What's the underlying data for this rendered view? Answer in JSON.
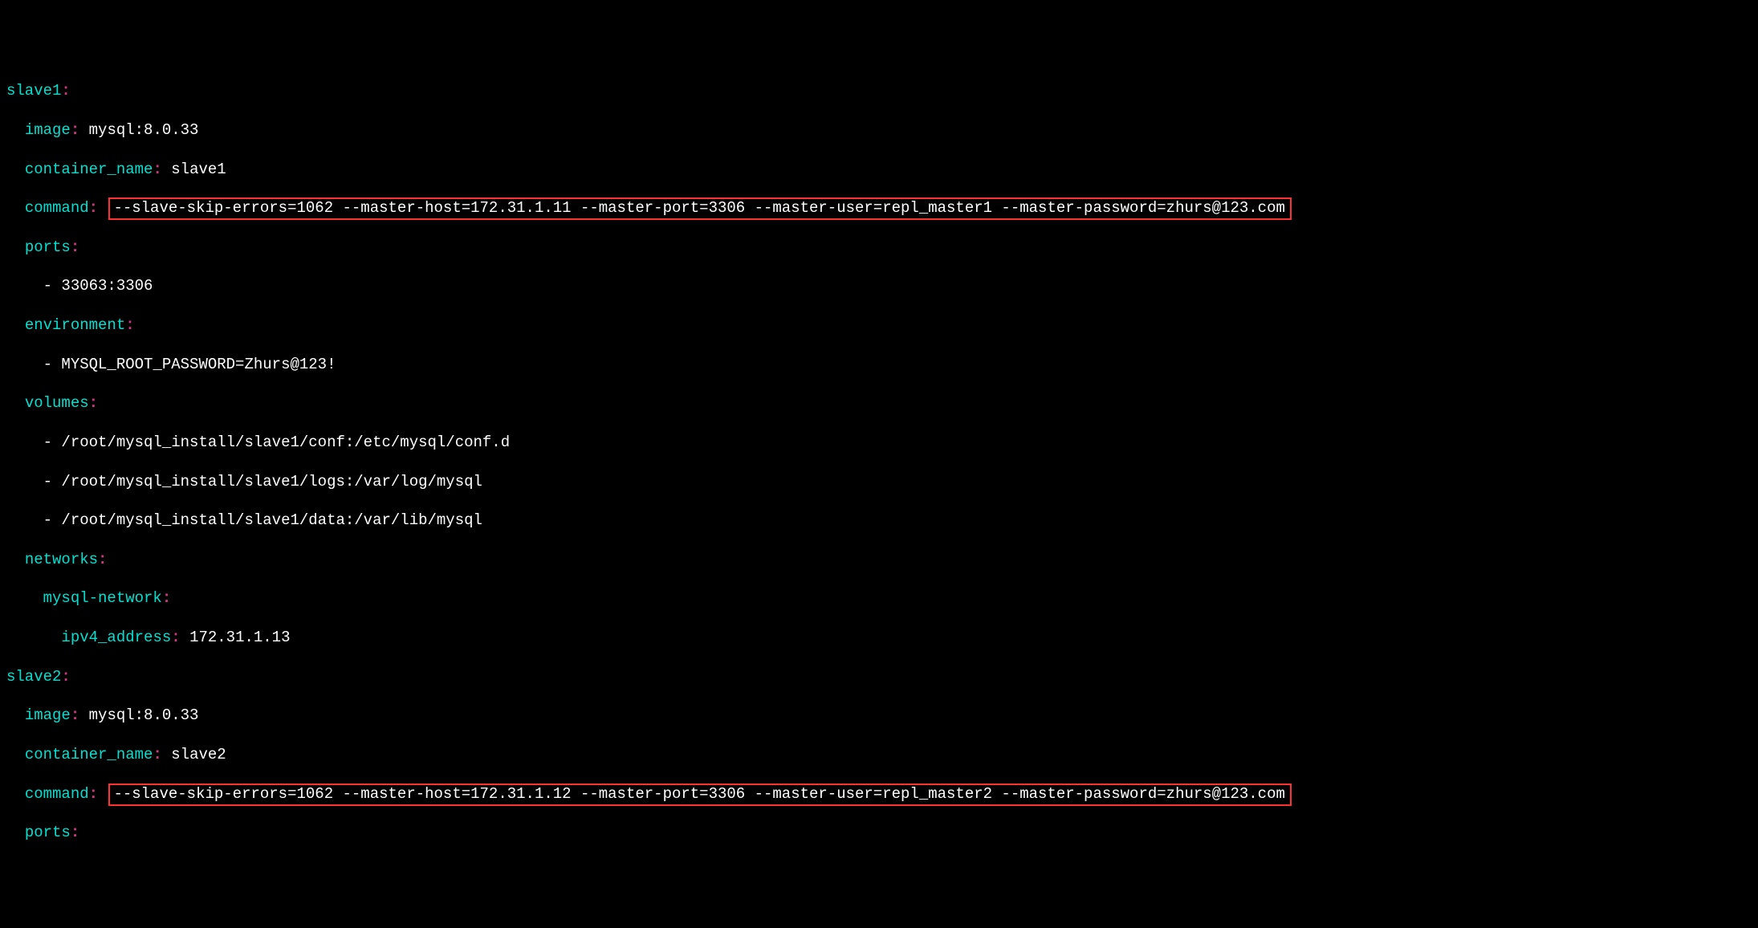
{
  "highlight_color": "#ff3030",
  "colors": {
    "key": "#00e0d0",
    "colon": "#d33682",
    "value": "#ffffff",
    "background": "#000000"
  },
  "slave1": {
    "name_key": "slave1",
    "image_key": "image",
    "image_val": "mysql:8.0.33",
    "container_key": "container_name",
    "container_val": "slave1",
    "command_key": "command",
    "command_val": "--slave-skip-errors=1062 --master-host=172.31.1.11 --master-port=3306 --master-user=repl_master1 --master-password=zhurs@123.com",
    "ports_key": "ports",
    "ports_item": "33063:3306",
    "env_key": "environment",
    "env_item": "MYSQL_ROOT_PASSWORD=Zhurs@123!",
    "vol_key": "volumes",
    "vol1": "/root/mysql_install/slave1/conf:/etc/mysql/conf.d",
    "vol2": "/root/mysql_install/slave1/logs:/var/log/mysql",
    "vol3": "/root/mysql_install/slave1/data:/var/lib/mysql",
    "net_key": "networks",
    "net_name_key": "mysql-network",
    "ipv4_key": "ipv4_address",
    "ipv4_val": "172.31.1.13"
  },
  "slave2": {
    "name_key": "slave2",
    "image_key": "image",
    "image_val": "mysql:8.0.33",
    "container_key": "container_name",
    "container_val": "slave2",
    "command_key": "command",
    "command_val": "--slave-skip-errors=1062 --master-host=172.31.1.12 --master-port=3306 --master-user=repl_master2 --master-password=zhurs@123.com",
    "ports_key": "ports"
  }
}
